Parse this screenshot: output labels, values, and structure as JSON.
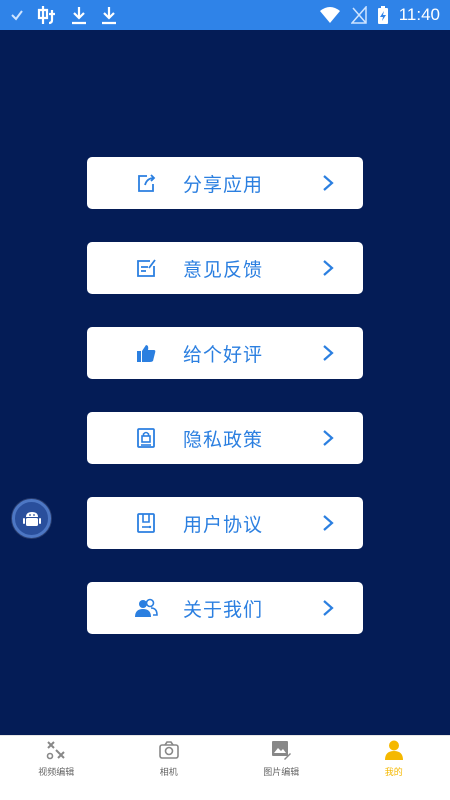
{
  "status_bar": {
    "time": "11:40",
    "left_icons": [
      "check-icon",
      "bug-icon",
      "download-icon",
      "download-icon"
    ],
    "right_icons": [
      "wifi-icon",
      "no-signal-icon",
      "battery-charging-icon"
    ]
  },
  "menu": {
    "items": [
      {
        "label": "分享应用",
        "icon": "share-icon"
      },
      {
        "label": "意见反馈",
        "icon": "feedback-icon"
      },
      {
        "label": "给个好评",
        "icon": "thumbs-up-icon"
      },
      {
        "label": "隐私政策",
        "icon": "privacy-lock-icon"
      },
      {
        "label": "用户协议",
        "icon": "agreement-document-icon"
      },
      {
        "label": "关于我们",
        "icon": "users-icon"
      }
    ]
  },
  "bottom_nav": {
    "items": [
      {
        "label": "视频编辑",
        "icon": "video-edit-icon"
      },
      {
        "label": "相机",
        "icon": "camera-icon"
      },
      {
        "label": "图片编辑",
        "icon": "image-edit-icon"
      },
      {
        "label": "我的",
        "icon": "profile-icon",
        "active": true
      }
    ]
  },
  "colors": {
    "background": "#041c56",
    "status_bar": "#2f83e8",
    "accent": "#2b7fe0",
    "active_tab": "#f5b800"
  }
}
